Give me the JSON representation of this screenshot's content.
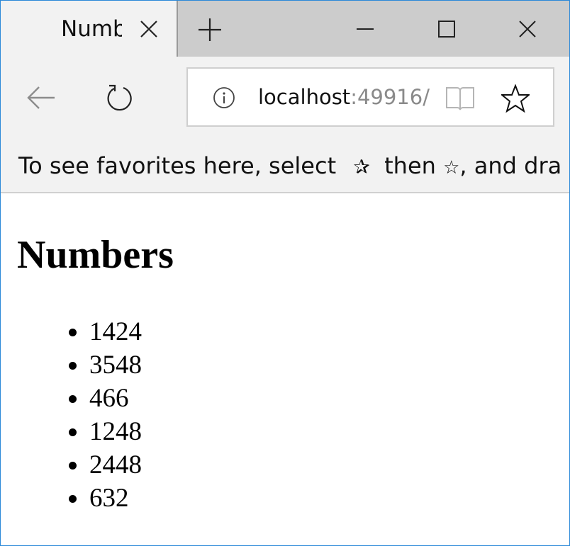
{
  "browser": {
    "tab": {
      "title": "Numb"
    },
    "address": {
      "host": "localhost",
      "rest": ":49916/"
    },
    "favorites_bar": {
      "text_before": "To see favorites here, select",
      "text_middle": "then",
      "text_after": ", and dra"
    },
    "icons": {
      "tab_close": "close-icon",
      "new_tab": "plus-icon",
      "minimize": "minimize-icon",
      "maximize": "maximize-icon",
      "close": "close-icon",
      "back": "back-arrow-icon",
      "refresh": "refresh-icon",
      "info": "info-icon",
      "reading_view": "book-icon",
      "favorite": "star-icon",
      "favorites_hub": "favorites-hub-icon"
    },
    "accent_color": "#2b88d8"
  },
  "page": {
    "heading": "Numbers",
    "items": [
      "1424",
      "3548",
      "466",
      "1248",
      "2448",
      "632"
    ]
  }
}
